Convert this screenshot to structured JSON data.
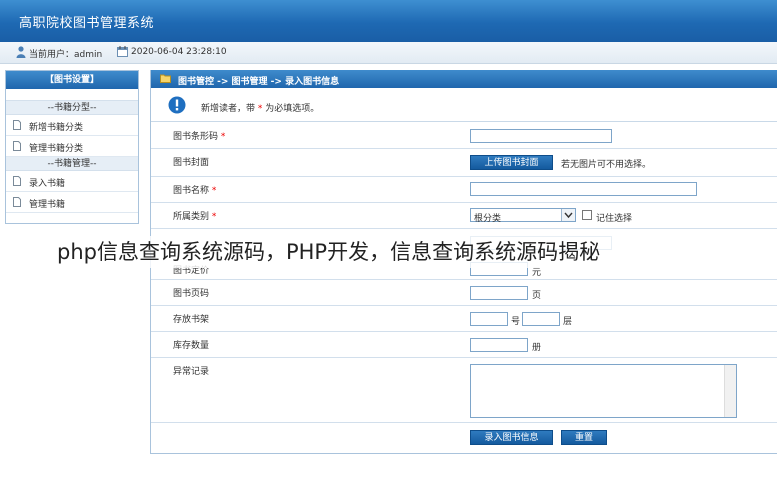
{
  "app": {
    "title": "高职院校图书管理系统"
  },
  "userbar": {
    "user": "当前用户：admin",
    "datetime": "2020-06-04 23:28:10"
  },
  "sidebar": {
    "header": "【图书设置】",
    "groups": [
      {
        "title": "--书籍分型--",
        "items": [
          "新增书籍分类",
          "管理书籍分类"
        ]
      },
      {
        "title": "--书籍管理--",
        "items": [
          "录入书籍",
          "管理书籍"
        ]
      }
    ]
  },
  "main": {
    "breadcrumb": "图书管控 -> 图书管理 -> 录入图书信息",
    "notice": {
      "before": "新增读者，带",
      "star": "*",
      "after": "为必填选项。"
    },
    "fields": {
      "barcode": {
        "label": "图书条形码",
        "required": "*"
      },
      "cover": {
        "label": "图书封面",
        "button": "上传图书封面",
        "hint": "若无图片可不用选择。"
      },
      "name": {
        "label": "图书名称",
        "required": "*"
      },
      "category": {
        "label": "所属类别",
        "required": "*",
        "selected": "根分类",
        "remember": "记住选择"
      },
      "price": {
        "label": "图书定价",
        "unit": "元"
      },
      "pages": {
        "label": "图书页码",
        "unit": "页"
      },
      "shelf": {
        "label": "存放书架",
        "unit_no": "号",
        "unit_floor": "层"
      },
      "stock": {
        "label": "库存数量",
        "unit": "册"
      },
      "note": {
        "label": "异常记录"
      }
    },
    "actions": {
      "submit": "录入图书信息",
      "reset": "重置"
    }
  },
  "overlay": {
    "caption": "php信息查询系统源码，PHP开发，信息查询系统源码揭秘"
  },
  "colors": {
    "header_blue": "#1e69b3",
    "required_red": "#e00000",
    "button_blue": "#1a62a6"
  }
}
